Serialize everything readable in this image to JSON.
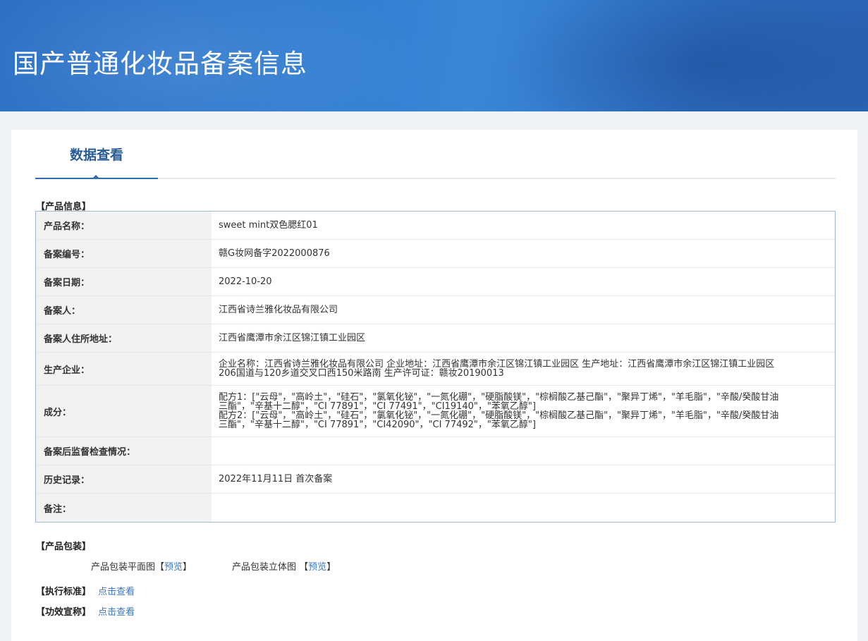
{
  "header": {
    "title": "国产普通化妆品备案信息"
  },
  "tabs": [
    {
      "label": "数据查看"
    }
  ],
  "product_info": {
    "section_title": "【产品信息】",
    "rows": [
      {
        "label": "产品名称：",
        "value": "sweet mint双色腮红01"
      },
      {
        "label": "备案编号：",
        "value": "赣G妆网备字2022000876"
      },
      {
        "label": "备案日期：",
        "value": "2022-10-20"
      },
      {
        "label": "备案人：",
        "value": "江西省诗兰雅化妆品有限公司"
      },
      {
        "label": "备案人住所地址：",
        "value": "江西省鹰潭市余江区锦江镇工业园区"
      },
      {
        "label": "生产企业：",
        "lines": [
          "企业名称：江西省诗兰雅化妆品有限公司 企业地址：江西省鹰潭市余江区锦江镇工业园区 生产地址：江西省鹰潭市余江区锦江镇工业园区",
          "206国道与120乡道交叉口西150米路南 生产许可证：赣妆20190013"
        ]
      },
      {
        "label": "成分：",
        "lines": [
          "配方1：[\"云母\"，\"高岭土\"，\"硅石\"，\"氯氧化铋\"，\"一氮化硼\"，\"硬脂酸镁\"，\"棕榈酸乙基己酯\"，\"聚异丁烯\"，\"羊毛脂\"，\"辛酸/癸酸甘油",
          "三酯\"，\"辛基十二醇\"，\"CI 77891\"，\"CI 77491\"，\"CI19140\"，\"苯氧乙醇\"]",
          "配方2：[\"云母\"，\"高岭土\"，\"硅石\"，\"氯氧化铋\"，\"一氮化硼\"，\"硬脂酸镁\"，\"棕榈酸乙基己酯\"，\"聚异丁烯\"，\"羊毛脂\"，\"辛酸/癸酸甘油",
          "三酯\"，\"辛基十二醇\"，\"CI 77891\"，\"CI42090\"，\"CI 77492\"，\"苯氧乙醇\"]"
        ]
      },
      {
        "label": "备案后监督检查情况：",
        "value": ""
      },
      {
        "label": "历史记录：",
        "value": "2022年11月11日 首次备案"
      },
      {
        "label": "备注：",
        "value": ""
      }
    ]
  },
  "packaging": {
    "section_title": "【产品包装】",
    "flat_label": "产品包装平面图",
    "flat_link": "预览",
    "solid_label": "产品包装立体图",
    "solid_link": "预览",
    "bracket_open": "【",
    "bracket_close": "】"
  },
  "standard": {
    "section_title": "【执行标准】",
    "link": "点击查看"
  },
  "efficacy": {
    "section_title": "【功效宣称】",
    "link": "点击查看"
  }
}
